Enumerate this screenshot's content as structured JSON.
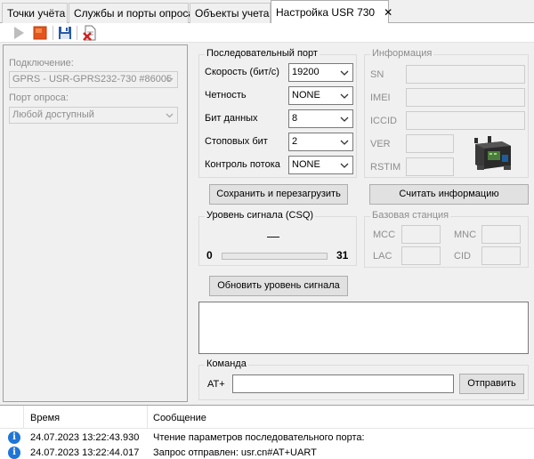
{
  "tabs": [
    {
      "label": "Точки учёта"
    },
    {
      "label": "Службы и порты опроса"
    },
    {
      "label": "Объекты учета"
    },
    {
      "label": "Настройка USR 730",
      "close": "✕"
    }
  ],
  "toolbar": {
    "icons": [
      "play-icon",
      "stop-icon",
      "save-icon",
      "delete-document-icon"
    ],
    "colors": {
      "play": "#bdbdbd",
      "stop": "#e5541c",
      "save": "#2a5aa8",
      "delete": "#d02020"
    }
  },
  "left": {
    "connection_label": "Подключение:",
    "connection_value": "GPRS - USR-GPRS232-730 #86005",
    "port_label": "Порт опроса:",
    "port_value": "Любой доступный"
  },
  "serial": {
    "title": "Последовательный порт",
    "fields": [
      {
        "label": "Скорость (бит/с)",
        "value": "19200"
      },
      {
        "label": "Четность",
        "value": "NONE"
      },
      {
        "label": "Бит данных",
        "value": "8"
      },
      {
        "label": "Стоповых бит",
        "value": "2"
      },
      {
        "label": "Контроль потока",
        "value": "NONE"
      }
    ],
    "save_button": "Сохранить и перезагрузить"
  },
  "info": {
    "title": "Информация",
    "fields": [
      {
        "label": "SN"
      },
      {
        "label": "IMEI"
      },
      {
        "label": "ICCID"
      },
      {
        "label": "VER"
      },
      {
        "label": "RSTIM"
      }
    ],
    "read_button": "Считать информацию"
  },
  "signal": {
    "title": "Уровень сигнала (CSQ)",
    "current": "—",
    "min": "0",
    "max": "31",
    "level": 0,
    "refresh_button": "Обновить уровень сигнала"
  },
  "base_station": {
    "title": "Базовая станция",
    "fields": [
      {
        "label": "MCC"
      },
      {
        "label": "MNC"
      },
      {
        "label": "LAC"
      },
      {
        "label": "CID"
      }
    ]
  },
  "command": {
    "title": "Команда",
    "prefix": "AT+",
    "value": "",
    "send_button": "Отправить"
  },
  "log": {
    "columns": [
      "Время",
      "Сообщение"
    ],
    "rows": [
      {
        "time": "24.07.2023 13:22:43.930",
        "message": "Чтение параметров последовательного порта:"
      },
      {
        "time": "24.07.2023 13:22:44.017",
        "message": "Запрос отправлен: usr.cn#AT+UART"
      }
    ]
  }
}
